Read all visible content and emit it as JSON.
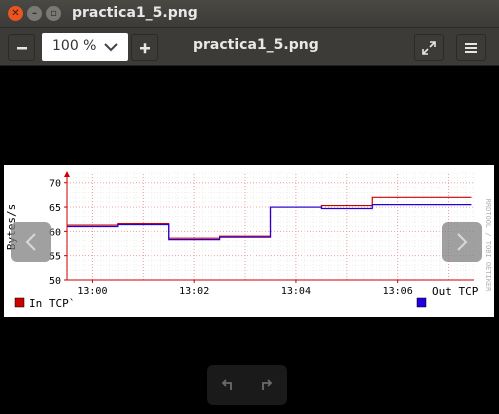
{
  "window": {
    "title": "practica1_5.png"
  },
  "toolbar": {
    "zoom_value": "100 %",
    "document_title": "practica1_5.png"
  },
  "chart_data": {
    "type": "line",
    "title": "",
    "xlabel": "",
    "ylabel": "Bytes/s",
    "x_ticks": [
      "13:00",
      "13:02",
      "13:04",
      "13:06"
    ],
    "y_ticks": [
      "50",
      "55",
      "60",
      "65",
      "70"
    ],
    "ylim": [
      50,
      72
    ],
    "xlim": [
      "12:59:30",
      "13:07:30"
    ],
    "side_label": "RRDTOOL / TOBI OETIKER",
    "grid": true,
    "legend_position": "bottom",
    "x": [
      "13:00",
      "13:01",
      "13:02",
      "13:03",
      "13:04",
      "13:05",
      "13:06",
      "13:07"
    ],
    "series": [
      {
        "name": "In TCP`",
        "color": "#cc0000",
        "values": [
          61.3,
          61.6,
          58.6,
          59.0,
          65.0,
          65.3,
          67.0,
          67.0
        ]
      },
      {
        "name": "Out TCP",
        "color": "#2000dd",
        "values": [
          61.0,
          61.4,
          58.3,
          58.8,
          65.0,
          64.7,
          65.5,
          65.5
        ]
      }
    ]
  }
}
